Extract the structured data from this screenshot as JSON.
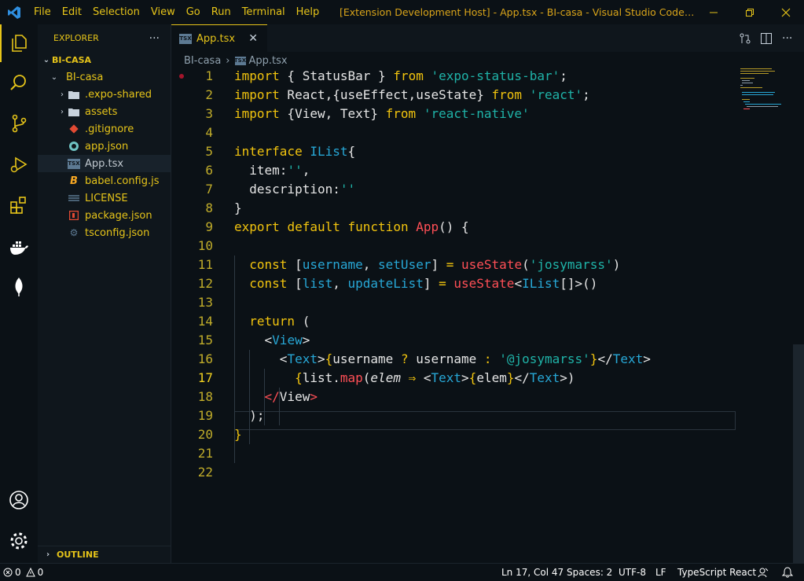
{
  "titlebar": {
    "menu": [
      "File",
      "Edit",
      "Selection",
      "View",
      "Go",
      "Run",
      "Terminal",
      "Help"
    ],
    "title": "[Extension Development Host] - App.tsx - BI-casa - Visual Studio Code [Administrat..."
  },
  "activity_bar": {
    "items": [
      "explorer-icon",
      "search-icon",
      "source-control-icon",
      "run-debug-icon",
      "extensions-icon",
      "docker-icon",
      "mongodb-leaf-icon"
    ],
    "bottom": [
      "account-icon",
      "settings-gear-icon"
    ]
  },
  "sidebar": {
    "title": "EXPLORER",
    "more": "···",
    "root": "BI-CASA",
    "folder": "BI-casa",
    "items": [
      {
        "label": ".expo-shared",
        "type": "folder",
        "icon": "folder-icon"
      },
      {
        "label": "assets",
        "type": "folder",
        "icon": "folder-icon"
      },
      {
        "label": ".gitignore",
        "type": "file",
        "icon": "git-icon"
      },
      {
        "label": "app.json",
        "type": "file",
        "icon": "json-icon"
      },
      {
        "label": "App.tsx",
        "type": "file",
        "icon": "tsx-icon",
        "badge": "TSX"
      },
      {
        "label": "babel.config.js",
        "type": "file",
        "icon": "babel-icon"
      },
      {
        "label": "LICENSE",
        "type": "file",
        "icon": "license-icon"
      },
      {
        "label": "package.json",
        "type": "file",
        "icon": "npm-icon"
      },
      {
        "label": "tsconfig.json",
        "type": "file",
        "icon": "tsconfig-icon"
      }
    ],
    "outline": "OUTLINE"
  },
  "editor": {
    "tab_label": "App.tsx",
    "tab_badge": "TSX",
    "close": "✕",
    "breadcrumb": [
      "BI-casa",
      "App.tsx"
    ],
    "line_numbers": [
      "1",
      "2",
      "3",
      "4",
      "5",
      "6",
      "7",
      "8",
      "9",
      "10",
      "11",
      "12",
      "13",
      "14",
      "15",
      "16",
      "17",
      "18",
      "19",
      "20",
      "21",
      "22"
    ],
    "current_line": 17
  },
  "statusbar": {
    "errors": "0",
    "warnings": "0",
    "position": "Ln 17, Col 47",
    "spaces": "Spaces: 2",
    "encoding": "UTF-8",
    "eol": "LF",
    "language": "TypeScript React"
  },
  "colors": {
    "accent": "#e6c419",
    "keyword": "#f2c40e",
    "string": "#1fb3a8",
    "identifier": "#27a7d6",
    "function": "#ff4f56",
    "background": "#0b1116"
  }
}
